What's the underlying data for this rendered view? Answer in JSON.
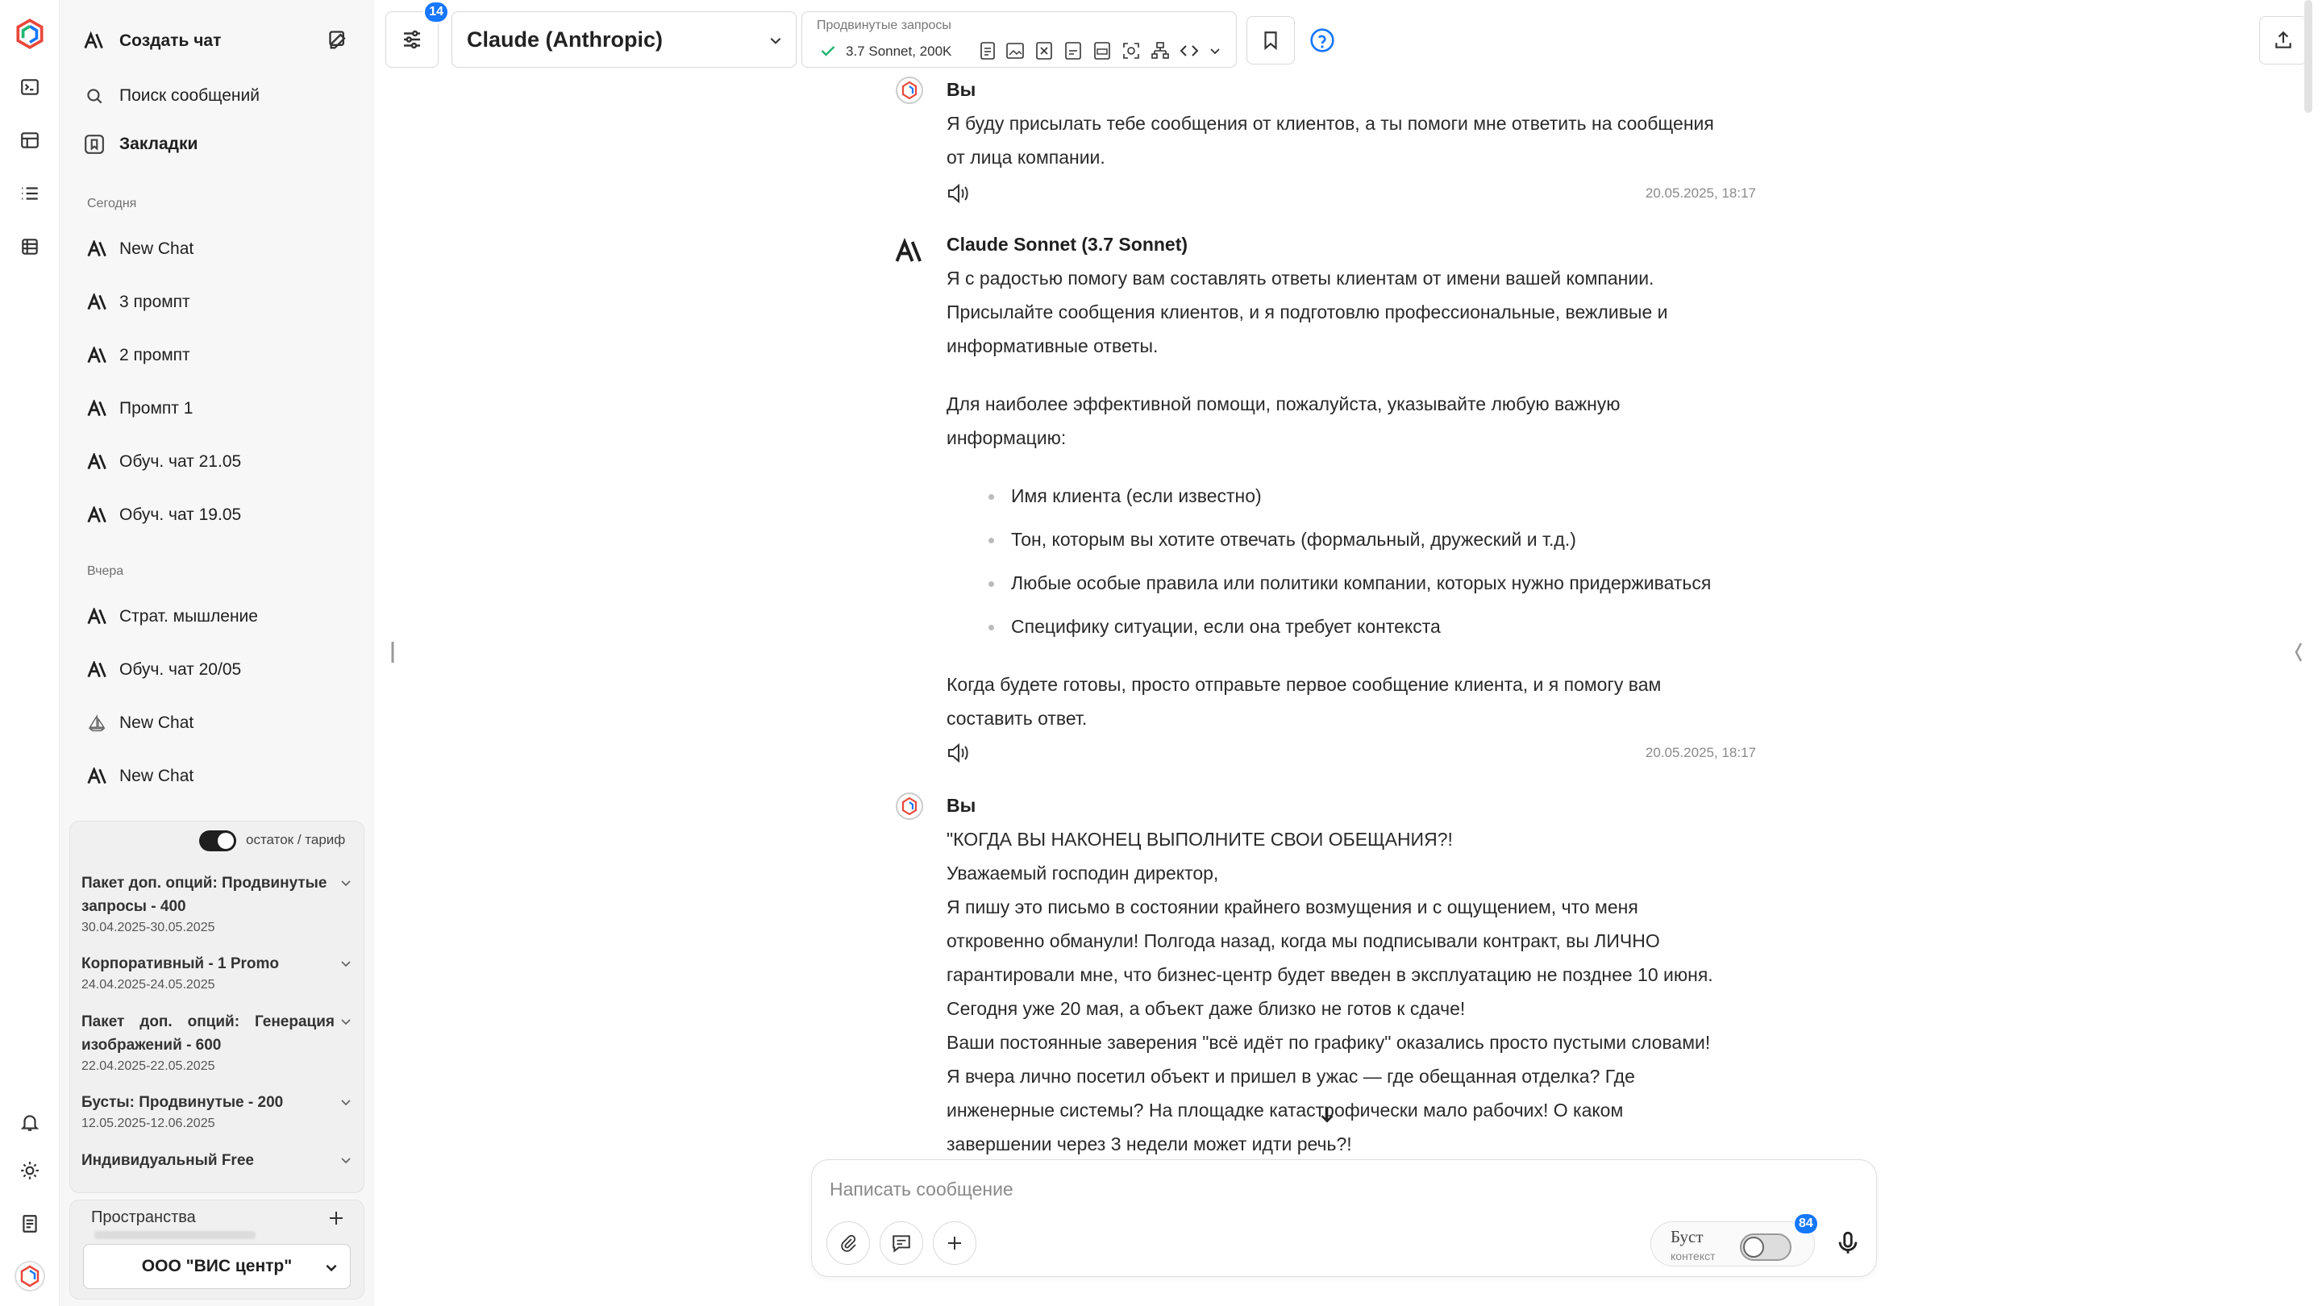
{
  "app": {
    "accent": "#1677ff",
    "icon_names": [
      "logo-icon",
      "terminal-icon",
      "table-icon",
      "list-icon",
      "database-icon",
      "bell-icon",
      "sun-icon",
      "document-icon",
      "avatar-logo-icon"
    ]
  },
  "sidebar": {
    "create_chat": "Создать чат",
    "search_label": "Поиск сообщений",
    "bookmarks_label": "Закладки",
    "today_header": "Сегодня",
    "today_items": [
      "New Chat",
      "3 промпт",
      "2 промпт",
      "Промпт 1",
      "Обуч. чат 21.05",
      "Обуч. чат 19.05"
    ],
    "yesterday_header": "Вчера",
    "yesterday_items": [
      "Страт. мышление",
      "Обуч. чат 20/05",
      "New Chat",
      "New Chat"
    ],
    "balance_toggle_label": "остаток / тариф",
    "balance_toggle_on": true,
    "tariffs": [
      {
        "name": "Пакет доп. опций: Продвинутые запросы - 400",
        "dates": "30.04.2025-30.05.2025"
      },
      {
        "name": "Корпоративный - 1 Promo",
        "dates": "24.04.2025-24.05.2025"
      },
      {
        "name": "Пакет доп. опций: Генерация изображений - 600",
        "dates": "22.04.2025-22.05.2025"
      },
      {
        "name": "Бусты: Продвинутые - 200",
        "dates": "12.05.2025-12.06.2025"
      },
      {
        "name": "Индивидуальный Free",
        "dates": ""
      }
    ],
    "spaces_label": "Пространства",
    "org_name": "ООО \"ВИС центр\""
  },
  "topbar": {
    "filter_badge": "14",
    "model_name": "Claude (Anthropic)",
    "advanced_label": "Продвинутые запросы",
    "advanced_value": "3.7 Sonnet, 200K"
  },
  "messages": {
    "m1": {
      "sender": "Вы",
      "lines": [
        "Я буду присылать тебе сообщения от клиентов, а ты помоги мне ответить на сообщения",
        "от лица компании."
      ],
      "time": "20.05.2025, 18:17"
    },
    "m2": {
      "sender": "Claude Sonnet (3.7 Sonnet)",
      "p1": [
        "Я с радостью помогу вам составлять ответы клиентам от имени вашей компании.",
        "Присылайте сообщения клиентов, и я подготовлю профессиональные, вежливые и",
        "информативные ответы."
      ],
      "p2": [
        "Для наиболее эффективной помощи, пожалуйста, указывайте любую важную",
        "информацию:"
      ],
      "bullets": [
        "Имя клиента (если известно)",
        "Тон, которым вы хотите отвечать (формальный, дружеский и т.д.)",
        "Любые особые правила или политики компании, которых нужно придерживаться",
        "Специфику ситуации, если она требует контекста"
      ],
      "p3": [
        "Когда будете готовы, просто отправьте первое сообщение клиента, и я помогу вам",
        "составить ответ."
      ],
      "time": "20.05.2025, 18:17"
    },
    "m3": {
      "sender": "Вы",
      "lines": [
        "\"КОГДА ВЫ НАКОНЕЦ ВЫПОЛНИТЕ СВОИ ОБЕЩАНИЯ?!",
        "Уважаемый господин директор,",
        "Я пишу это письмо в состоянии крайнего возмущения и с ощущением, что меня",
        "откровенно обманули! Полгода назад, когда мы подписывали контракт, вы ЛИЧНО",
        "гарантировали мне, что бизнес-центр будет введен в эксплуатацию не позднее 10 июня.",
        "Сегодня уже 20 мая, а объект даже близко не готов к сдаче!",
        "Ваши постоянные заверения \"всё идёт по графику\" оказались просто пустыми словами!",
        "Я вчера лично посетил объект и пришел в ужас — где обещанная отделка? Где",
        "инженерные системы? На площадке катастрофически мало рабочих! О каком",
        "завершении через 3 недели может идти речь?!"
      ]
    }
  },
  "composer": {
    "placeholder": "Написать сообщение",
    "boost_label": "Буст",
    "boost_sub": "контекст",
    "boost_badge": "84"
  }
}
